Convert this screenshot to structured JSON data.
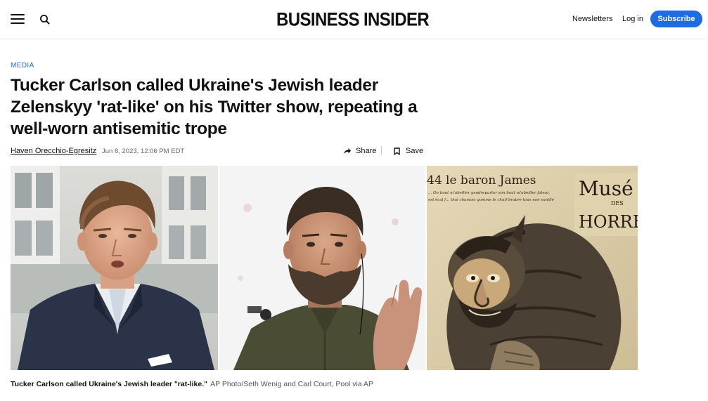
{
  "header": {
    "logo": "BUSINESS INSIDER",
    "newsletters": "Newsletters",
    "login": "Log in",
    "subscribe": "Subscribe"
  },
  "article": {
    "category": "MEDIA",
    "headline": "Tucker Carlson called Ukraine's Jewish leader Zelenskyy 'rat-like' on his Twitter show, repeating a well-worn antisemitic trope",
    "author": "Haven Orecchio-Egresitz",
    "date": "Jun 8, 2023, 12:06 PM EDT",
    "share": "Share",
    "save": "Save"
  },
  "illustration": {
    "title_line": "44 le baron James",
    "small_line_1": "... On bout m'abeiller gendreparter son bout m'abeiller faleur,",
    "small_line_2": "est écal f... thai chamois gomme le chuif brabre tous non vanille",
    "sign_line_1": "Musé",
    "sign_line_2": "DES",
    "sign_line_3": "HORREUI"
  },
  "caption": {
    "text": "Tucker Carlson called Ukraine's Jewish leader \"rat-like.\"",
    "credit": "AP Photo/Seth Wenig and Carl Court, Pool via AP"
  },
  "colors": {
    "accent": "#1f6be6",
    "text": "#111111",
    "muted": "#666666"
  }
}
